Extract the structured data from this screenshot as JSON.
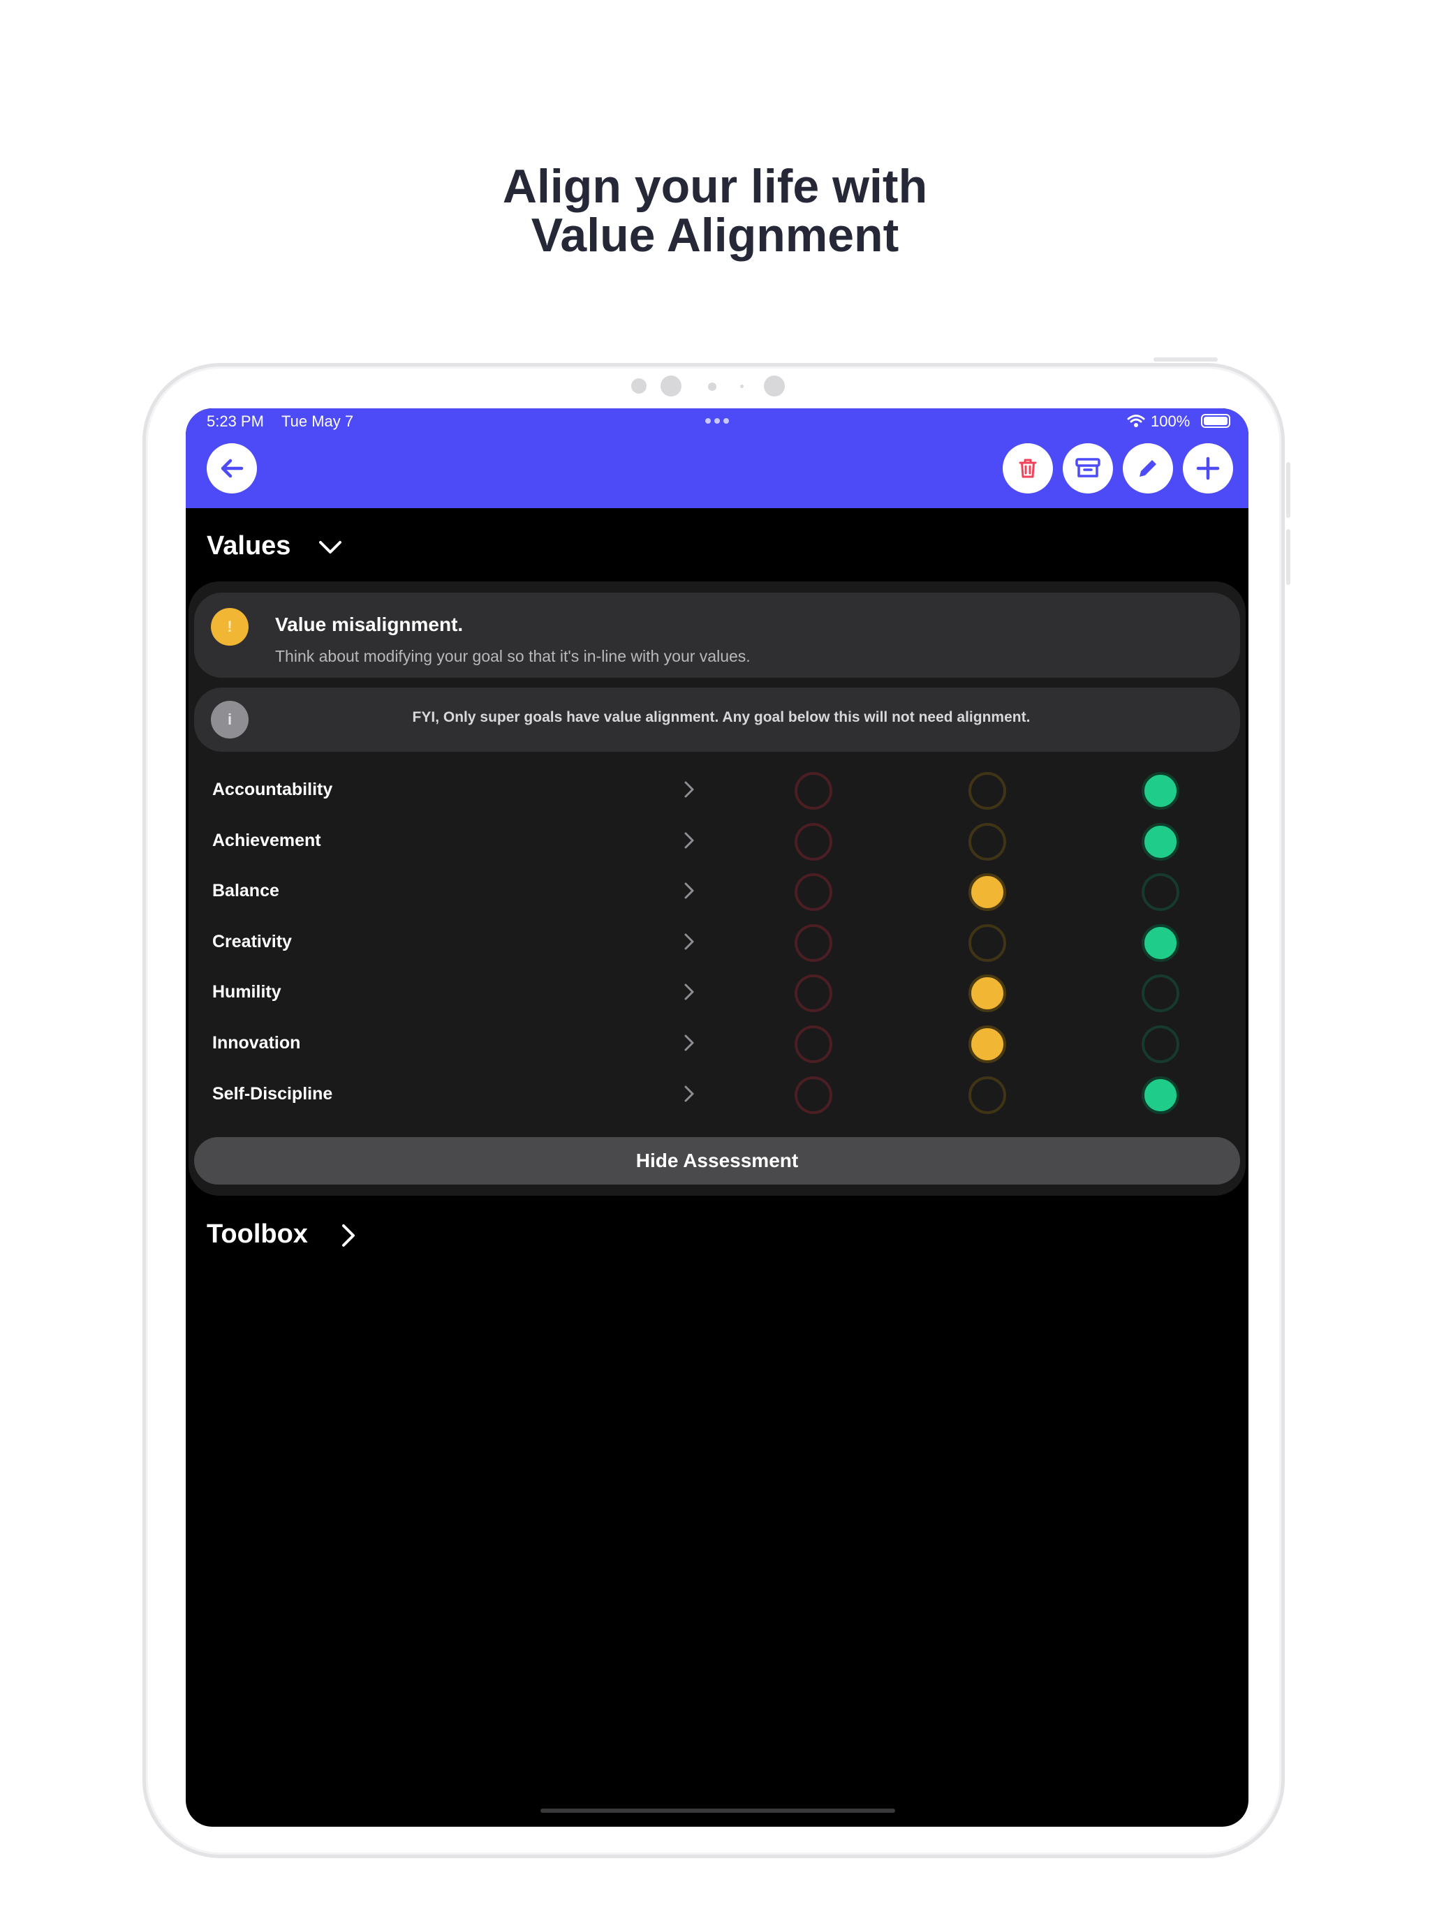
{
  "promo": {
    "line1": "Align your life with",
    "line2": "Value Alignment"
  },
  "status_bar": {
    "time": "5:23 PM",
    "date": "Tue May 7",
    "battery": "100%"
  },
  "toolbar": {
    "back_icon": "arrow-left-icon",
    "actions": [
      {
        "name": "delete",
        "icon": "trash-icon",
        "color": "#f0435a"
      },
      {
        "name": "archive",
        "icon": "archive-icon",
        "color": "#4d4af7"
      },
      {
        "name": "edit",
        "icon": "pencil-icon",
        "color": "#4d4af7"
      },
      {
        "name": "add",
        "icon": "plus-icon",
        "color": "#4d4af7"
      }
    ]
  },
  "values_section": {
    "title": "Values",
    "warning": {
      "badge": "!",
      "title": "Value misalignment.",
      "subtitle": "Think about modifying your goal so that it's in-line with your values."
    },
    "info": {
      "badge": "i",
      "text": "FYI, Only super goals have value alignment. Any goal below this will not need alignment."
    },
    "rows": [
      {
        "label": "Accountability",
        "selected": "green"
      },
      {
        "label": "Achievement",
        "selected": "green"
      },
      {
        "label": "Balance",
        "selected": "yellow"
      },
      {
        "label": "Creativity",
        "selected": "green"
      },
      {
        "label": "Humility",
        "selected": "yellow"
      },
      {
        "label": "Innovation",
        "selected": "yellow"
      },
      {
        "label": "Self-Discipline",
        "selected": "green"
      }
    ],
    "hide_button": "Hide Assessment"
  },
  "toolbox_section": {
    "title": "Toolbox"
  },
  "colors": {
    "accent": "#4d4af7",
    "warning": "#f0b634",
    "success": "#1fcc8a",
    "danger": "#f0435a"
  }
}
